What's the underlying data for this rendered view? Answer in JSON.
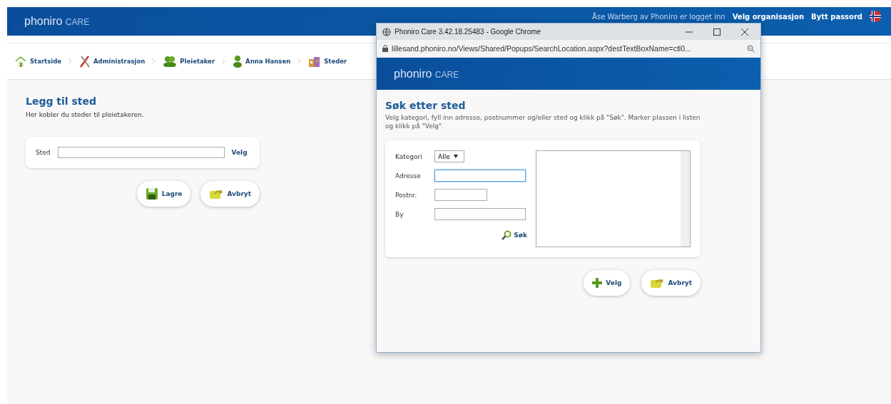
{
  "header": {
    "logo": "phoniro",
    "logo_suffix": "CARE",
    "user_text": "Åse Warberg av Phoniro er logget inn",
    "links": [
      "Velg organisasjon",
      "Bytt passord"
    ]
  },
  "breadcrumbs": [
    {
      "label": "Startside",
      "kind": "home"
    },
    {
      "label": "Administrasjon",
      "kind": "tools"
    },
    {
      "label": "Pleietaker",
      "kind": "group"
    },
    {
      "label": "Anna Hansen",
      "kind": "person"
    },
    {
      "label": "Steder",
      "kind": "places"
    }
  ],
  "page": {
    "title": "Legg til sted",
    "description": "Her kobler du steder til pleietakeren.",
    "field_label": "Sted",
    "field_link": "Velg",
    "buttons": [
      {
        "label": "Lagre",
        "kind": "save"
      },
      {
        "label": "Avbryt",
        "kind": "undo"
      }
    ]
  },
  "popup": {
    "window_title": "Phoniro Care 3.42.18.25483 - Google Chrome",
    "url": "lillesand.phoniro.no/Views/Shared/Popups/SearchLocation.aspx?destTextBoxName=ctl0...",
    "logo": "phoniro",
    "logo_suffix": "CARE",
    "title": "Søk etter sted",
    "description": "Velg kategori, fyll inn adresse, postnummer og/eller sted og klikk på \"Søk\". Marker plassen i listen og klikk på \"Velg\".",
    "fields": [
      {
        "label": "Kategori",
        "kind": "select",
        "value": "Alle"
      },
      {
        "label": "Adresse",
        "kind": "text",
        "focused": true
      },
      {
        "label": "Postnr.",
        "kind": "short"
      },
      {
        "label": "By",
        "kind": "text",
        "focused": false
      }
    ],
    "search_button": "Søk",
    "buttons": [
      {
        "label": "Velg",
        "kind": "add"
      },
      {
        "label": "Avbryt",
        "kind": "undo"
      }
    ]
  }
}
